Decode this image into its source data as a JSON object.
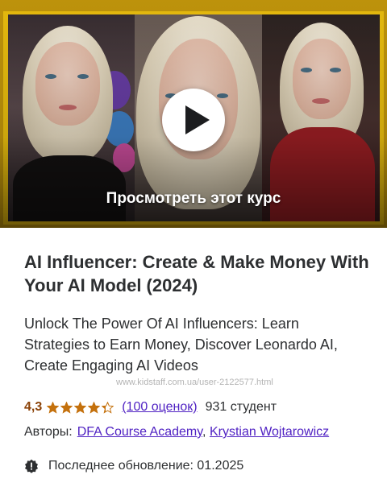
{
  "preview": {
    "label": "Просмотреть этот курс",
    "play_icon": "play-icon"
  },
  "course": {
    "title": "AI Influencer: Create & Make Money With Your AI Model (2024)",
    "subtitle": "Unlock The Power Of AI Influencers: Learn Strategies to Earn Money, Discover Leonardo AI, Create Engaging AI Videos",
    "rating": {
      "value": "4,3",
      "stars": 4.3,
      "reviews_label": "(100 оценок)",
      "students": "931 студент"
    },
    "authors": {
      "label": "Авторы:",
      "list": [
        "DFA Course Academy",
        "Krystian Wojtarowicz"
      ],
      "separator": ","
    },
    "last_update": {
      "icon": "alert-badge-icon",
      "text": "Последнее обновление: 01.2025"
    }
  },
  "watermark": "www.kidstaff.com.ua/user-2122577.html",
  "colors": {
    "accent_purple": "#5022c3",
    "rating_orange": "#8b4309",
    "star_gold": "#c4710d",
    "frame_yellow": "#f0c30f"
  }
}
